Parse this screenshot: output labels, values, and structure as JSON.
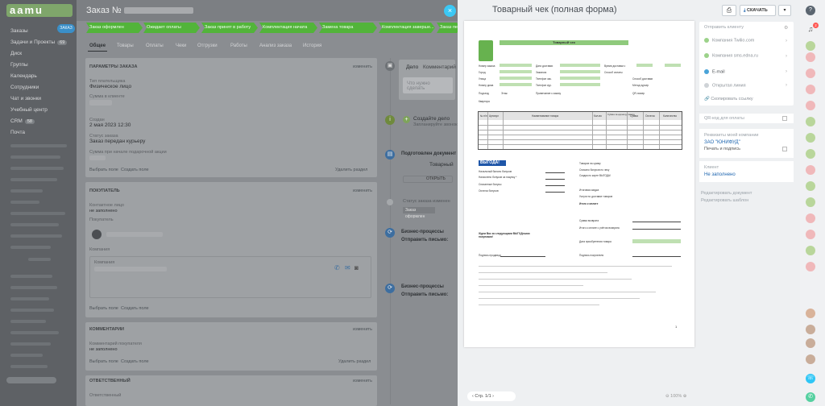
{
  "app": {
    "logo": "aamu"
  },
  "sidebar": {
    "items": [
      {
        "label": "Заказы",
        "count": ""
      },
      {
        "label": "Задачи и Проекты",
        "count": "69"
      },
      {
        "label": "Диск",
        "count": ""
      },
      {
        "label": "Группы",
        "count": ""
      },
      {
        "label": "Календарь",
        "count": ""
      },
      {
        "label": "Сотрудники",
        "count": ""
      },
      {
        "label": "Чат и звонки",
        "count": ""
      },
      {
        "label": "Учебный центр",
        "count": ""
      },
      {
        "label": "CRM",
        "count": "58"
      },
      {
        "label": "Почта",
        "count": ""
      }
    ],
    "orders_badge": "ЗАКАЗ"
  },
  "order": {
    "title": "Заказ №",
    "stages": [
      "Заказ оформлен",
      "Ожидает оплаты",
      "Заказ принят в работу",
      "Комплектация начата",
      "Замена товара",
      "Комплектация заверше...",
      "Заказ переда..."
    ],
    "tabs": [
      "Общее",
      "Товары",
      "Оплаты",
      "Чеки",
      "Отгрузки",
      "Работы",
      "Анализ заказа",
      "История"
    ],
    "params": {
      "header": "ПАРАМЕТРЫ ЗАКАЗА",
      "change": "изменить",
      "payer_type_label": "Тип плательщика",
      "payer_type": "Физическое лицо",
      "client_sum_label": "Сумма в клиенте",
      "created_label": "Создан",
      "created": "2 мая 2023 12:30",
      "status_label": "Статус заказа",
      "status": "Заказ передан курьеру",
      "sum_label": "Сумма при начале подарочной акции",
      "select_field": "Выбрать поле",
      "create_field": "Создать поле",
      "delete_section": "Удалить раздел"
    },
    "buyer": {
      "header": "ПОКУПАТЕЛЬ",
      "contact_label": "Контактное лицо",
      "contact": "не заполнено",
      "buyer_label": "Покупатель",
      "company_label": "Компания",
      "comp_sub": "Компания"
    },
    "comments": {
      "header": "КОММЕНТАРИИ",
      "label": "Комментарий покупателя",
      "value": "не заполнено",
      "delete": "Удалить раздел"
    },
    "responsible": {
      "header": "ОТВЕТСТВЕННЫЙ",
      "label": "Ответственный"
    },
    "timeline": {
      "tabs": [
        "Дело",
        "Комментарий"
      ],
      "placeholder": "Что нужно сделать",
      "create_deal": "Создайте дело",
      "create_deal_sub": "Запланируйте звонок",
      "prepared_doc": "Подготовлен документ",
      "doc_link": "Товарный",
      "open_btn": "ОТКРЫТЬ",
      "status_changed": "Статус заказа изменен",
      "status_from": "Заказ оформлен",
      "bp1": "Бизнес-процессы",
      "bp1_sub": "Отправить письмо:",
      "bp2": "Бизнес-процессы",
      "bp2_sub": "Отправить письмо:"
    }
  },
  "slider": {
    "close": "×",
    "title": "Товарный чек (полная форма)",
    "print_icon": "printer-icon",
    "download": "СКАЧАТЬ",
    "page_label": "Стр.",
    "page": "1/1",
    "zoom": "100%",
    "send": {
      "title": "Отправить клиенту",
      "channels": [
        "Компания Twilio.com",
        "Компания sms.edna.ru",
        "E-mail",
        "Открытая линия"
      ],
      "copy_link": "Скопировать ссылку",
      "qr": "QR-код для оплаты",
      "requisites_label": "Реквизиты моей компании",
      "company": "ЗАО \"ЮНИФУД\"",
      "print_sign": "Печать и подпись",
      "client_label": "Клиент",
      "client_value": "Не заполнено",
      "edit_doc": "Редактировать документ",
      "edit_template": "Редактировать шаблон"
    },
    "doc": {
      "header": "Товарный чек",
      "rows_left": [
        "Номер заказа",
        "Город",
        "Улица",
        "Номер дома",
        "Подъезд",
        "Квартира"
      ],
      "rows_mid": [
        "Дата доставки",
        "Заказчик",
        "Телефон зак.",
        "Телефон кур.",
        "Примечание к заказу"
      ],
      "rows_right": [
        "Время доставки с",
        "Способ оплаты",
        "Способ доставки",
        "Метод курьер",
        "QR-номер"
      ],
      "floor": "Этаж",
      "col_headers": [
        "№ п/п",
        "Артикул",
        "Наименование товара",
        "Кол-во",
        "Сумма за единицу товара",
        "Сумма",
        "Остаток",
        "Количество"
      ],
      "promo": "ВЫГОДА!",
      "bonus_rows": [
        "Начальный баланс бонусов",
        "Начислено бонусов за покупку *",
        "Списанные бонусы",
        "Остаток бонусов"
      ],
      "right_rows": [
        "Товаров на сумму",
        "Списано бонусов по чеку",
        "Скидка по карте ВЫГОДА!",
        "Итоговая скидка",
        "Услуги по доставке товаров",
        "Итого к оплате"
      ],
      "return_rows": [
        "Сумма возврата",
        "Итого к оплате с учётом возврата",
        "Дата приобретения товара",
        "Подпись покупателя"
      ],
      "thanks": "Ждем Вас за следующими ВЫГОДными покупками!",
      "seller_sign": "Подпись продавца",
      "page_num": "1"
    }
  },
  "rightbar": {
    "help_icon": "help-icon",
    "notif_icon": "bell-icon",
    "notif_count": "2"
  }
}
